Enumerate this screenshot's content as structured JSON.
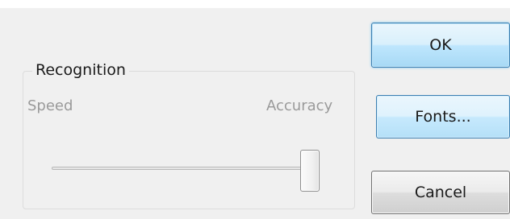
{
  "dialog": {
    "group_title": "Recognition",
    "slider": {
      "min_label": "Speed",
      "max_label": "Accuracy",
      "value_fraction": 1.0
    }
  },
  "buttons": {
    "ok_label": "OK",
    "fonts_label": "Fonts...",
    "cancel_label": "Cancel"
  }
}
